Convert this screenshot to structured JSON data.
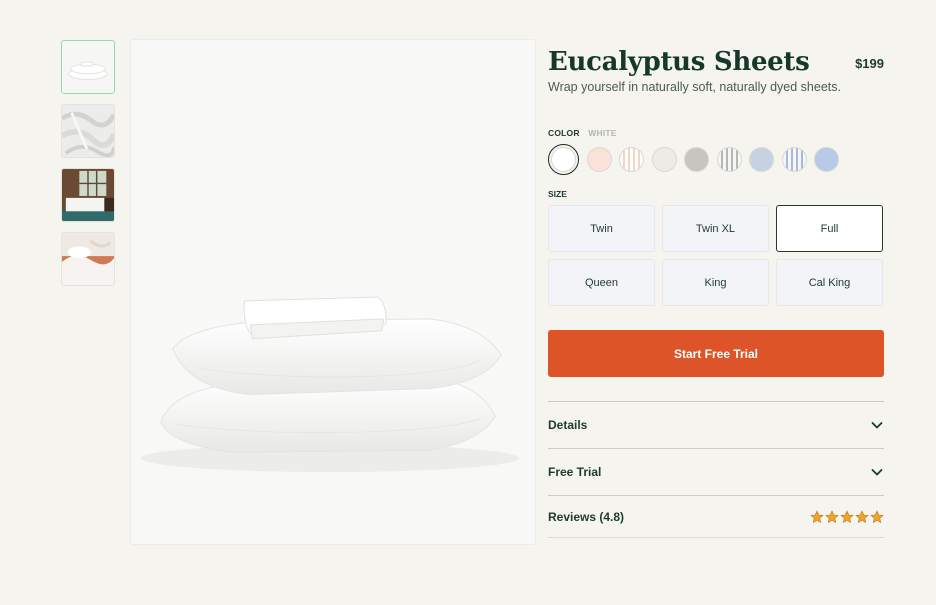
{
  "product": {
    "title": "Eucalyptus Sheets",
    "price": "$199",
    "subtitle": "Wrap yourself in naturally soft, naturally dyed sheets."
  },
  "gallery": {
    "thumbnails": [
      "pillows-white",
      "sheet-texture",
      "bedroom-scene",
      "bed-closeup"
    ],
    "active_index": 0
  },
  "color": {
    "label": "COLOR",
    "selected_name": "WHITE",
    "swatches": [
      "#ffffff",
      "#fbe2d8",
      "stripe-peach",
      "#ecebe7",
      "#c8c4bf",
      "stripe-gray",
      "#c6d2e4",
      "stripe-blue",
      "#b9c9e8"
    ]
  },
  "size": {
    "label": "SIZE",
    "options": [
      "Twin",
      "Twin XL",
      "Full",
      "Queen",
      "King",
      "Cal King"
    ],
    "selected": "Full"
  },
  "cta": {
    "label": "Start Free Trial",
    "color": "#dd5428"
  },
  "accordion": {
    "details": "Details",
    "free_trial": "Free Trial",
    "reviews": "Reviews (4.8)"
  },
  "reviews": {
    "rating": 4.8,
    "stars": 5,
    "star_color": "#f0a32a"
  },
  "icons": {
    "chevron": "chevron-down-icon",
    "star": "star-icon"
  }
}
